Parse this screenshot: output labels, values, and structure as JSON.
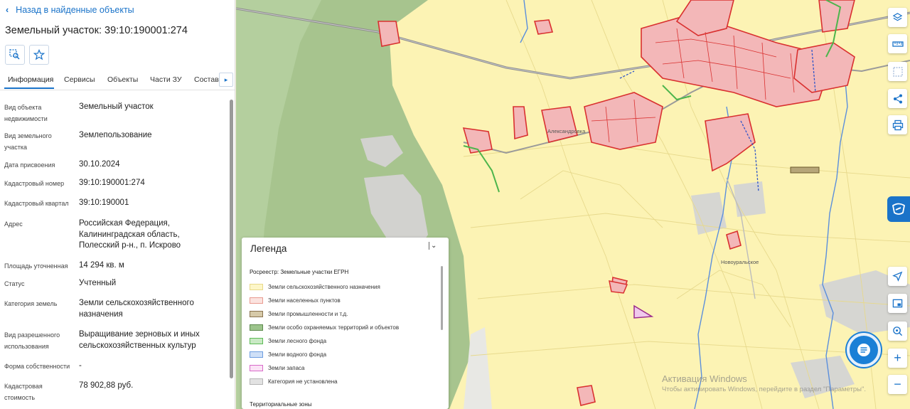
{
  "panel": {
    "back_label": "Назад в найденные объекты",
    "title": "Земельный участок: 39:10:190001:274",
    "tabs": [
      "Информация",
      "Сервисы",
      "Объекты",
      "Части ЗУ",
      "Состав"
    ],
    "properties": [
      {
        "label": "Вид объекта недвижимости",
        "value": "Земельный участок"
      },
      {
        "label": "Вид земельного участка",
        "value": "Землепользование"
      },
      {
        "label": "Дата присвоения",
        "value": "30.10.2024"
      },
      {
        "label": "Кадастровый номер",
        "value": "39:10:190001:274"
      },
      {
        "label": "Кадастровый квартал",
        "value": "39:10:190001"
      },
      {
        "label": "Адрес",
        "value": "Российская Федерация, Калининградская область, Полесский р-н., п. Искрово"
      },
      {
        "label": "Площадь уточненная",
        "value": "14 294 кв. м"
      },
      {
        "label": "Статус",
        "value": "Учтенный"
      },
      {
        "label": "Категория земель",
        "value": "Земли сельскохозяйственного назначения"
      },
      {
        "label": "Вид разрешенного использования",
        "value": "Выращивание зерновых и иных сельскохозяйственных культур"
      },
      {
        "label": "Форма собственности",
        "value": "-"
      },
      {
        "label": "Кадастровая стоимость",
        "value": "78 902,88 руб."
      }
    ]
  },
  "legend": {
    "title": "Легенда",
    "subtitle": "Росреестр: Земельные участки ЕГРН",
    "items": [
      {
        "label": "Земли сельскохозяйственного назначения",
        "fill": "#fdf6c8",
        "stroke": "#e8d98a"
      },
      {
        "label": "Земли населенных пунктов",
        "fill": "#fbe3df",
        "stroke": "#e99a90"
      },
      {
        "label": "Земли промышленности и т.д.",
        "fill": "#d6c9a8",
        "stroke": "#8a7350"
      },
      {
        "label": "Земли особо охраняемых территорий и объектов",
        "fill": "#9cc48c",
        "stroke": "#5d8a4e"
      },
      {
        "label": "Земли лесного фонда",
        "fill": "#c9e9c4",
        "stroke": "#5dbb55"
      },
      {
        "label": "Земли водного фонда",
        "fill": "#cfe0f7",
        "stroke": "#6e9ee0"
      },
      {
        "label": "Земли запаса",
        "fill": "#fbe3f6",
        "stroke": "#d86bc9"
      },
      {
        "label": "Категория не установлена",
        "fill": "#e2e2e2",
        "stroke": "#b5b5b5"
      }
    ],
    "section2": "Территориальные зоны"
  },
  "map": {
    "labels": [
      "Александровка",
      "Новоуральское"
    ],
    "watermark_title": "Активация Windows",
    "watermark_text": "Чтобы активировать Windows, перейдите в раздел \"Параметры\"."
  },
  "tools": [
    "layers-icon",
    "ruler-icon",
    "select-area-icon",
    "share-icon",
    "print-icon",
    "locate-icon",
    "minimap-icon",
    "search-location-icon",
    "zoom-in-icon",
    "zoom-out-icon"
  ]
}
